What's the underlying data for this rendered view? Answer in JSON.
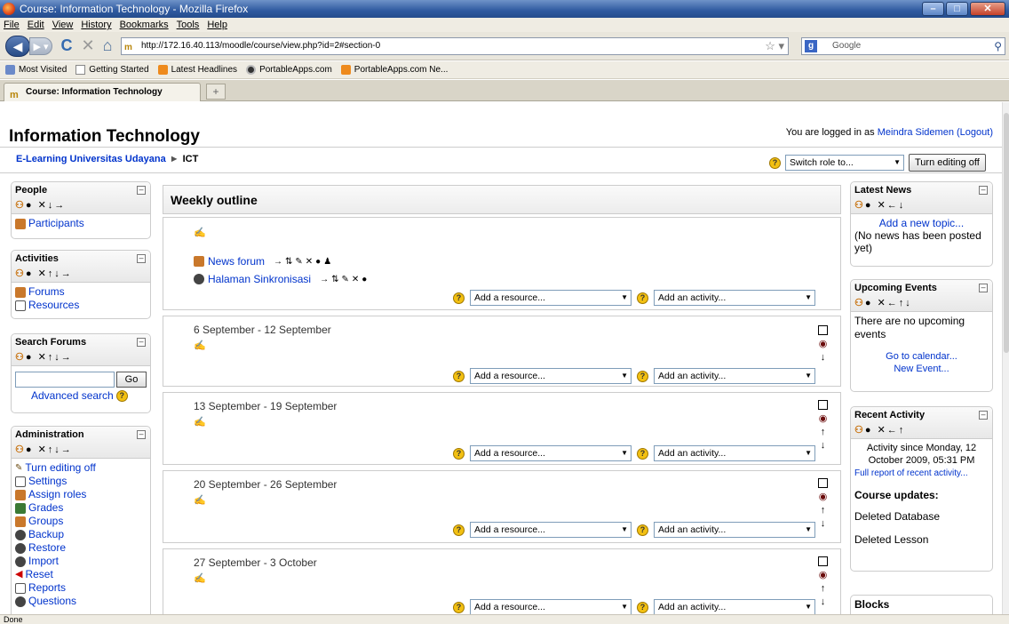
{
  "window": {
    "title": "Course: Information Technology - Mozilla Firefox"
  },
  "menu": [
    "File",
    "Edit",
    "View",
    "History",
    "Bookmarks",
    "Tools",
    "Help"
  ],
  "urlbar": {
    "url": "http://172.16.40.113/moodle/course/view.php?id=2#section-0"
  },
  "search": {
    "placeholder": "Google"
  },
  "bookmarks": [
    "Most Visited",
    "Getting Started",
    "Latest Headlines",
    "PortableApps.com",
    "PortableApps.com Ne..."
  ],
  "tab": {
    "label": "Course: Information Technology"
  },
  "header": {
    "course_title": "Information Technology",
    "login_prefix": "You are logged in as ",
    "user": "Meindra Sidemen",
    "logout": "(Logout)",
    "breadcrumb_home": "E-Learning Universitas Udayana",
    "breadcrumb_sep": "►",
    "breadcrumb_current": "ICT",
    "switch_role": "Switch role to...",
    "turn_editing": "Turn editing off"
  },
  "left": {
    "people": {
      "title": "People",
      "items": [
        "Participants"
      ]
    },
    "activities": {
      "title": "Activities",
      "items": [
        "Forums",
        "Resources"
      ]
    },
    "search_forums": {
      "title": "Search Forums",
      "go": "Go",
      "advanced": "Advanced search"
    },
    "administration": {
      "title": "Administration",
      "items": [
        "Turn editing off",
        "Settings",
        "Assign roles",
        "Grades",
        "Groups",
        "Backup",
        "Restore",
        "Import",
        "Reset",
        "Reports",
        "Questions"
      ]
    }
  },
  "main": {
    "heading": "Weekly outline",
    "topic0": {
      "activities": [
        "News forum",
        "Halaman Sinkronisasi"
      ]
    },
    "add_resource": "Add a resource...",
    "add_activity": "Add an activity...",
    "weeks": [
      "6 September - 12 September",
      "13 September - 19 September",
      "20 September - 26 September",
      "27 September - 3 October"
    ]
  },
  "right": {
    "latest_news": {
      "title": "Latest News",
      "add": "Add a new topic...",
      "empty": "(No news has been posted yet)"
    },
    "upcoming": {
      "title": "Upcoming Events",
      "empty": "There are no upcoming events",
      "calendar": "Go to calendar...",
      "new_event": "New Event..."
    },
    "recent": {
      "title": "Recent Activity",
      "since": "Activity since Monday, 12 October 2009, 05:31 PM",
      "full_report": "Full report of recent activity...",
      "updates_title": "Course updates:",
      "updates": [
        "Deleted Database",
        "Deleted Lesson"
      ]
    },
    "blocks": {
      "title": "Blocks"
    }
  },
  "status": {
    "text": "Done"
  }
}
